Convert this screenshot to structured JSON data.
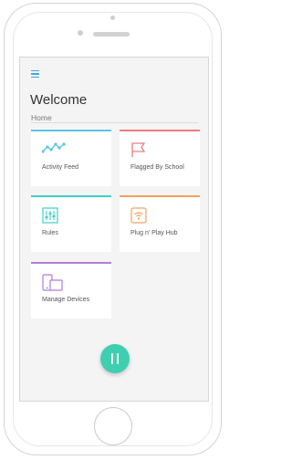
{
  "header": {
    "title": "Welcome",
    "breadcrumb": "Home"
  },
  "tiles": [
    {
      "label": "Activity Feed",
      "icon": "activity-line-icon",
      "color": "#5bc4e8"
    },
    {
      "label": "Flagged By School",
      "icon": "flag-icon",
      "color": "#ee7d7d"
    },
    {
      "label": "Rules",
      "icon": "sliders-icon",
      "color": "#3fcfc6"
    },
    {
      "label": "Plug n' Play Hub",
      "icon": "wifi-hub-icon",
      "color": "#f4a259"
    },
    {
      "label": "Manage Devices",
      "icon": "devices-icon",
      "color": "#b07cd8"
    }
  ],
  "colors": {
    "accent": "#3fa8e0",
    "fab": "#3fcfb0"
  },
  "fab": {
    "icon": "pause-icon"
  }
}
